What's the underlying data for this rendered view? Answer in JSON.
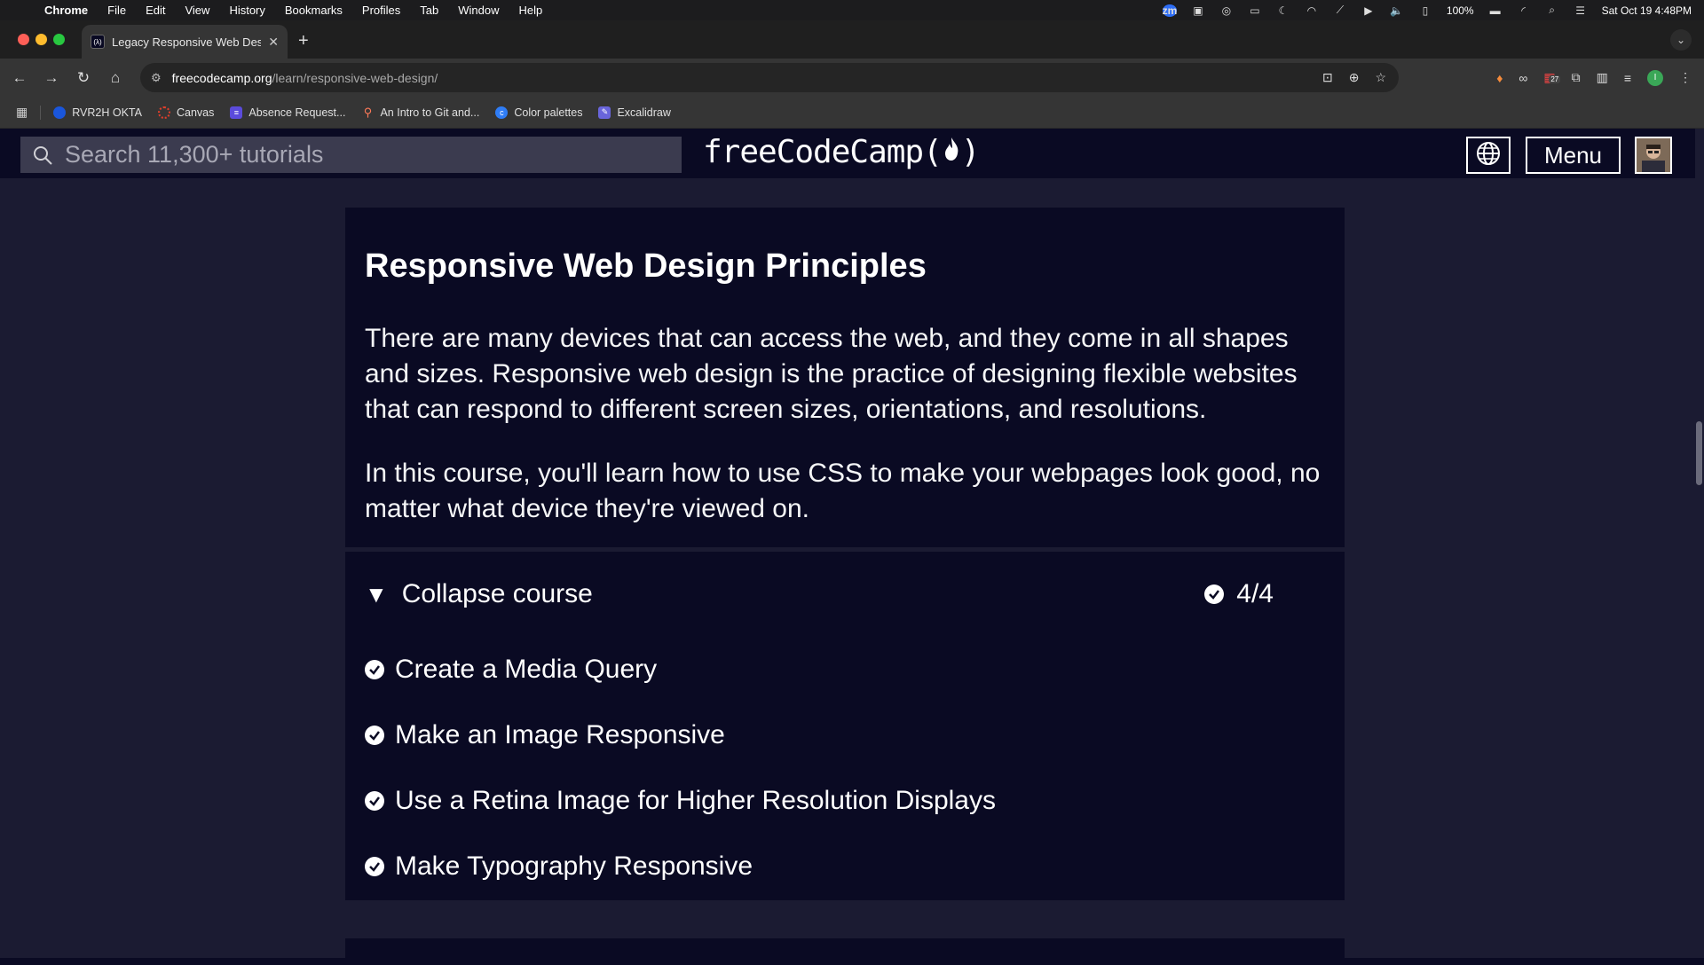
{
  "menubar": {
    "app_name": "Chrome",
    "items": [
      "File",
      "Edit",
      "View",
      "History",
      "Bookmarks",
      "Profiles",
      "Tab",
      "Window",
      "Help"
    ],
    "battery": "100%",
    "clock": "Sat Oct 19  4:48PM",
    "zoom_label": "zm"
  },
  "browser": {
    "tab_title": "Legacy Responsive Web Design",
    "favicon_text": "(λ)",
    "url_host": "freecodecamp.org",
    "url_path": "/learn/responsive-web-design/",
    "extension_badge": "27",
    "profile_initial": "I"
  },
  "bookmarks": [
    {
      "label": "RVR2H OKTA",
      "icon": "okta-icon",
      "color": "#1a56db"
    },
    {
      "label": "Canvas",
      "icon": "canvas-icon",
      "color": "#e13f2b"
    },
    {
      "label": "Absence Request...",
      "icon": "form-icon",
      "color": "#5b4bdb"
    },
    {
      "label": "An Intro to Git and...",
      "icon": "hubspot-icon",
      "color": "#ff7a59"
    },
    {
      "label": "Color palettes",
      "icon": "coolors-icon",
      "color": "#2f7df6"
    },
    {
      "label": "Excalidraw",
      "icon": "excalidraw-icon",
      "color": "#6965db"
    }
  ],
  "fcc": {
    "search_placeholder": "Search 11,300+ tutorials",
    "logo_text": "freeCodeCamp(",
    "logo_close": ")",
    "menu_label": "Menu"
  },
  "intro": {
    "title": "Responsive Web Design Principles",
    "paragraph1": "There are many devices that can access the web, and they come in all shapes and sizes. Responsive web design is the practice of designing flexible websites that can respond to different screen sizes, orientations, and resolutions.",
    "paragraph2": "In this course, you'll learn how to use CSS to make your webpages look good, no matter what device they're viewed on."
  },
  "course": {
    "collapse_label": "Collapse course",
    "progress": "4/4",
    "lessons": [
      "Create a Media Query",
      "Make an Image Responsive",
      "Use a Retina Image for Higher Resolution Displays",
      "Make Typography Responsive"
    ]
  },
  "colors": {
    "background": "#1b1b32",
    "card": "#0a0a23",
    "search": "#3b3b4f"
  }
}
